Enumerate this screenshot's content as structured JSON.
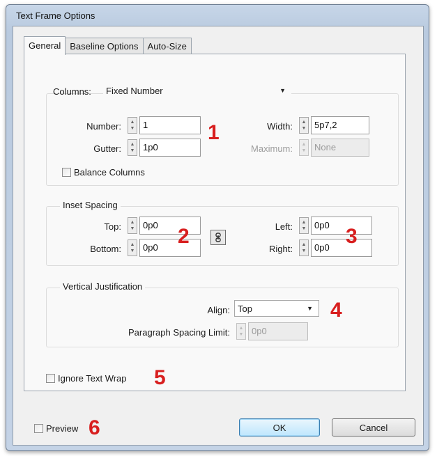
{
  "window": {
    "title": "Text Frame Options"
  },
  "tabs": [
    {
      "label": "General",
      "active": true
    },
    {
      "label": "Baseline Options",
      "active": false
    },
    {
      "label": "Auto-Size",
      "active": false
    }
  ],
  "columns": {
    "label": "Columns:",
    "mode": "Fixed Number",
    "number_label": "Number:",
    "number_value": "1",
    "gutter_label": "Gutter:",
    "gutter_value": "1p0",
    "width_label": "Width:",
    "width_value": "5p7,2",
    "maximum_label": "Maximum:",
    "maximum_value": "None",
    "balance_label": "Balance Columns",
    "balance_checked": false
  },
  "inset": {
    "title": "Inset Spacing",
    "top_label": "Top:",
    "top_value": "0p0",
    "bottom_label": "Bottom:",
    "bottom_value": "0p0",
    "left_label": "Left:",
    "left_value": "0p0",
    "right_label": "Right:",
    "right_value": "0p0"
  },
  "vertical": {
    "title": "Vertical Justification",
    "align_label": "Align:",
    "align_value": "Top",
    "spacing_label": "Paragraph Spacing Limit:",
    "spacing_value": "0p0"
  },
  "ignore_wrap": {
    "label": "Ignore Text Wrap",
    "checked": false
  },
  "footer": {
    "preview_label": "Preview",
    "preview_checked": false,
    "ok_label": "OK",
    "cancel_label": "Cancel"
  },
  "callouts": [
    "1",
    "2",
    "3",
    "4",
    "5",
    "6"
  ],
  "colors": {
    "callout": "#d81f1f",
    "default_button": "#bee6fd"
  },
  "icons": {
    "link": "chain-link-icon",
    "spin": "spinner-arrows-icon",
    "dropdown": "chevron-down-icon"
  }
}
